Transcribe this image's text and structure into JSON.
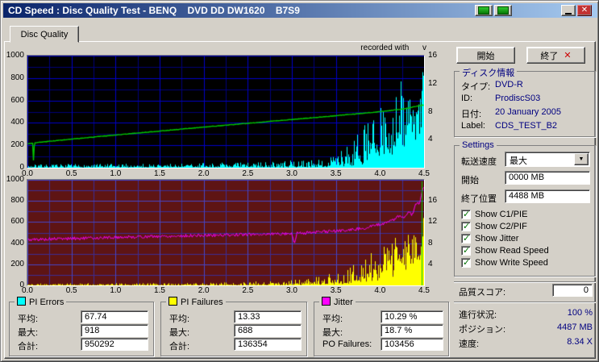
{
  "window": {
    "title": "CD Speed : Disc Quality Test - BENQ    DVD DD DW1620    B7S9"
  },
  "icons": {
    "check": "✓",
    "close": "✕",
    "dropdown_arrow": "▼",
    "exit_x": "✕"
  },
  "tabs": {
    "disc_quality": "Disc Quality"
  },
  "chart_header": {
    "recorded_with": "recorded with      v"
  },
  "actions": {
    "start": "開始",
    "exit": "終了"
  },
  "disc_info": {
    "title": "ディスク情報",
    "rows": [
      {
        "label": "タイプ:",
        "value": "DVD-R"
      },
      {
        "label": "ID:",
        "value": "ProdiscS03"
      },
      {
        "label": "日付:",
        "value": "20 January 2005"
      },
      {
        "label": "Label:",
        "value": "CDS_TEST_B2"
      }
    ]
  },
  "settings": {
    "title": "Settings",
    "transfer_speed": {
      "label": "転送速度",
      "value": "最大"
    },
    "start": {
      "label": "開始",
      "value": "0000 MB"
    },
    "end": {
      "label": "終了位置",
      "value": "4488 MB"
    },
    "checkboxes": [
      {
        "label": "Show C1/PIE",
        "checked": true
      },
      {
        "label": "Show C2/PIF",
        "checked": true
      },
      {
        "label": "Show Jitter",
        "checked": true
      },
      {
        "label": "Show Read Speed",
        "checked": true
      },
      {
        "label": "Show Write Speed",
        "checked": true
      }
    ]
  },
  "quality": {
    "label": "品質スコア:",
    "value": "0"
  },
  "status": {
    "rows": [
      {
        "label": "進行状況:",
        "value": "100 %"
      },
      {
        "label": "ポジション:",
        "value": "4487 MB"
      },
      {
        "label": "速度:",
        "value": "8.34 X"
      }
    ]
  },
  "legend_panels": [
    {
      "title": "PI Errors",
      "swatch": "#00ffff",
      "rows": [
        {
          "label": "平均:",
          "value": "67.74"
        },
        {
          "label": "最大:",
          "value": "918"
        },
        {
          "label": "合計:",
          "value": "950292"
        }
      ]
    },
    {
      "title": "PI Failures",
      "swatch": "#ffff00",
      "rows": [
        {
          "label": "平均:",
          "value": "13.33"
        },
        {
          "label": "最大:",
          "value": "688"
        },
        {
          "label": "合計:",
          "value": "136354"
        }
      ]
    },
    {
      "title": "Jitter",
      "swatch": "#ff00ff",
      "rows": [
        {
          "label": "平均:",
          "value": "10.29 %"
        },
        {
          "label": "最大:",
          "value": "18.7 %"
        },
        {
          "label": "PO Failures:",
          "value": "103456"
        }
      ]
    }
  ],
  "chart_data": [
    {
      "type": "spikes+line",
      "name": "pi-errors-and-write-speed",
      "bg": "#000000",
      "grid_minor": "#00007a",
      "grid_major": "#0000c8",
      "x_min": 0,
      "x_max": 4.5,
      "v_max": 1000,
      "x_tick_labels": [
        "0.0",
        "0.5",
        "1.0",
        "1.5",
        "2.0",
        "2.5",
        "3.0",
        "3.5",
        "4.0",
        "4.5"
      ],
      "left_tick_labels": [
        "1000",
        "800",
        "600",
        "400",
        "200",
        "0"
      ],
      "right_ticks": [
        {
          "t": "16",
          "f": 0
        },
        {
          "t": "12",
          "f": 0.25
        },
        {
          "t": "8",
          "f": 0.5
        },
        {
          "t": "4",
          "f": 0.75
        }
      ],
      "series": [
        {
          "name": "PI Errors",
          "kind": "spikes",
          "color": "#00ffff",
          "seed": 7,
          "base": [
            [
              0,
              4
            ],
            [
              3.0,
              6
            ],
            [
              3.4,
              12
            ],
            [
              3.7,
              30
            ],
            [
              3.9,
              80
            ],
            [
              4.05,
              150
            ],
            [
              4.2,
              260
            ],
            [
              4.35,
              400
            ],
            [
              4.5,
              520
            ]
          ],
          "peak": [
            [
              0,
              30
            ],
            [
              1.5,
              38
            ],
            [
              2.7,
              55
            ],
            [
              3.2,
              70
            ],
            [
              3.5,
              130
            ],
            [
              3.7,
              260
            ],
            [
              3.85,
              420
            ],
            [
              4.0,
              560
            ],
            [
              4.1,
              700
            ],
            [
              4.25,
              840
            ],
            [
              4.38,
              940
            ],
            [
              4.5,
              1000
            ]
          ]
        },
        {
          "name": "Write Speed",
          "kind": "line",
          "color": "#00c800",
          "seed": 3,
          "noise": 2,
          "width": 1.4,
          "points": [
            [
              0,
              215
            ],
            [
              0.055,
              218
            ],
            [
              0.065,
              52
            ],
            [
              0.075,
              222
            ],
            [
              0.3,
              240
            ],
            [
              0.6,
              262
            ],
            [
              1.0,
              292
            ],
            [
              1.5,
              327
            ],
            [
              2.0,
              362
            ],
            [
              2.5,
              396
            ],
            [
              3.0,
              430
            ],
            [
              3.5,
              464
            ],
            [
              3.9,
              492
            ],
            [
              4.1,
              508
            ],
            [
              4.3,
              528
            ],
            [
              4.42,
              548
            ],
            [
              4.48,
              558
            ]
          ]
        }
      ]
    },
    {
      "type": "spikes+line",
      "name": "pi-failures-and-jitter",
      "bg": "#5e1414",
      "grid_minor": "#3c2c96",
      "grid_major": "#4646c8",
      "x_min": 0,
      "x_max": 4.5,
      "v_max": 1000,
      "x_tick_labels": [
        "0.0",
        "0.5",
        "1.0",
        "1.5",
        "2.0",
        "2.5",
        "3.0",
        "3.5",
        "4.0",
        "4.5"
      ],
      "left_tick_labels": [
        "1000",
        "800",
        "600",
        "400",
        "200",
        "0"
      ],
      "right_ticks": [
        {
          "t": "16",
          "f": 0.2
        },
        {
          "t": "12",
          "f": 0.4
        },
        {
          "t": "8",
          "f": 0.6
        },
        {
          "t": "4",
          "f": 0.8
        }
      ],
      "series": [
        {
          "name": "PI Failures",
          "kind": "spikes",
          "color": "#ffff00",
          "seed": 11,
          "base": [
            [
              0,
              2
            ],
            [
              2.5,
              3
            ],
            [
              3.2,
              8
            ],
            [
              3.6,
              25
            ],
            [
              3.9,
              70
            ],
            [
              4.1,
              140
            ],
            [
              4.3,
              260
            ],
            [
              4.5,
              380
            ]
          ],
          "peak": [
            [
              0,
              18
            ],
            [
              2.0,
              25
            ],
            [
              3.0,
              50
            ],
            [
              3.4,
              100
            ],
            [
              3.7,
              200
            ],
            [
              3.95,
              340
            ],
            [
              4.15,
              480
            ],
            [
              4.3,
              600
            ],
            [
              4.42,
              690
            ],
            [
              4.5,
              700
            ]
          ]
        },
        {
          "name": "Jitter",
          "kind": "line",
          "color": "#ff00ff",
          "seed": 5,
          "noise": 15,
          "width": 1,
          "points": [
            [
              0,
              432
            ],
            [
              0.3,
              440
            ],
            [
              0.7,
              448
            ],
            [
              1.0,
              455
            ],
            [
              1.5,
              465
            ],
            [
              2.0,
              473
            ],
            [
              2.5,
              482
            ],
            [
              2.9,
              490
            ],
            [
              3.0,
              492
            ],
            [
              3.03,
              398
            ],
            [
              3.06,
              494
            ],
            [
              3.3,
              505
            ],
            [
              3.6,
              520
            ],
            [
              3.8,
              540
            ],
            [
              3.95,
              565
            ],
            [
              4.05,
              590
            ],
            [
              4.15,
              620
            ],
            [
              4.22,
              655
            ],
            [
              4.28,
              640
            ],
            [
              4.33,
              700
            ],
            [
              4.37,
              668
            ],
            [
              4.4,
              740
            ],
            [
              4.43,
              800
            ],
            [
              4.45,
              758
            ],
            [
              4.47,
              850
            ],
            [
              4.5,
              930
            ]
          ]
        },
        {
          "name": "End Marker",
          "kind": "vline",
          "color": "#00c800",
          "x": 4.47,
          "v1": 0,
          "v2": 985
        }
      ]
    }
  ]
}
